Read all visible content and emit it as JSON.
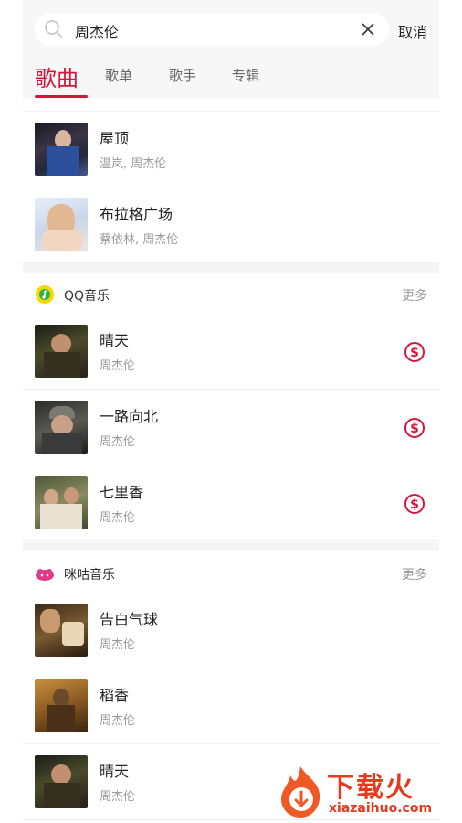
{
  "search": {
    "query": "周杰伦",
    "cancel_label": "取消"
  },
  "tabs": [
    {
      "label": "歌曲"
    },
    {
      "label": "歌单"
    },
    {
      "label": "歌手"
    },
    {
      "label": "专辑"
    }
  ],
  "top_songs": [
    {
      "title": "屋顶",
      "artist": "温岚, 周杰伦"
    },
    {
      "title": "布拉格广场",
      "artist": "蔡依林, 周杰伦"
    }
  ],
  "qq_section": {
    "title": "QQ音乐",
    "more_label": "更多",
    "songs": [
      {
        "title": "晴天",
        "artist": "周杰伦"
      },
      {
        "title": "一路向北",
        "artist": "周杰伦"
      },
      {
        "title": "七里香",
        "artist": "周杰伦"
      }
    ]
  },
  "migu_section": {
    "title": "咪咕音乐",
    "more_label": "更多",
    "songs": [
      {
        "title": "告白气球",
        "artist": "周杰伦"
      },
      {
        "title": "稻香",
        "artist": "周杰伦"
      },
      {
        "title": "晴天",
        "artist": "周杰伦"
      }
    ]
  },
  "watermark": {
    "title": "下载火",
    "url": "xiazaihuo.com"
  },
  "colors": {
    "accent": "#d4163c",
    "pay_icon": "#d4163c",
    "watermark": "#e63a1e"
  }
}
